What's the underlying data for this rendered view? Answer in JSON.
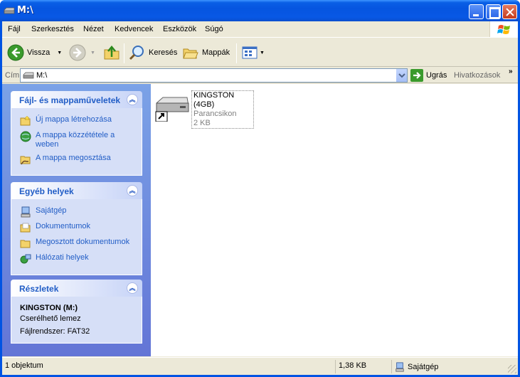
{
  "window": {
    "title": "M:\\"
  },
  "menu": [
    "Fájl",
    "Szerkesztés",
    "Nézet",
    "Kedvencek",
    "Eszközök",
    "Súgó"
  ],
  "toolbar": {
    "back": "Vissza",
    "search": "Keresés",
    "folders": "Mappák"
  },
  "address": {
    "label": "Cím",
    "value": "M:\\",
    "go": "Ugrás",
    "links": "Hivatkozások",
    "more": "»"
  },
  "tasks_panel": {
    "title": "Fájl- és mappaműveletek",
    "items": [
      "Új mappa létrehozása",
      "A mappa közzététele a weben",
      "A mappa megosztása"
    ]
  },
  "places_panel": {
    "title": "Egyéb helyek",
    "items": [
      "Sajátgép",
      "Dokumentumok",
      "Megosztott dokumentumok",
      "Hálózati helyek"
    ]
  },
  "details_panel": {
    "title": "Részletek",
    "name": "KINGSTON (M:)",
    "type": "Cserélhető lemez",
    "fs": "Fájlrendszer: FAT32"
  },
  "file": {
    "name": "KINGSTON (4GB)",
    "type": "Parancsikon",
    "size": "2 KB"
  },
  "status": {
    "count": "1 objektum",
    "size": "1,38 KB",
    "location": "Sajátgép"
  },
  "colors": {
    "titlebar": "#0655e0",
    "taskpane": "#7ba2e7",
    "link": "#215dc6"
  }
}
